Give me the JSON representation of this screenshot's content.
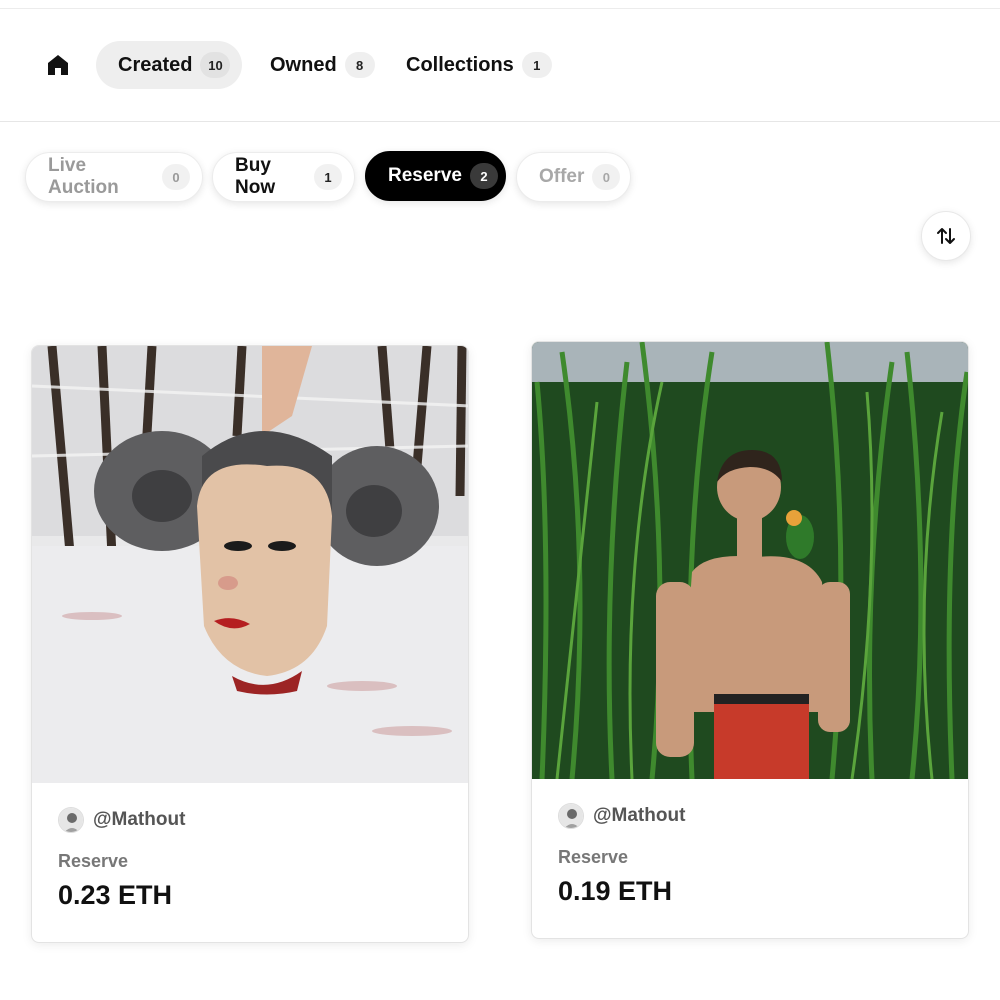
{
  "main_tabs": [
    {
      "label": "Created",
      "count": "10"
    },
    {
      "label": "Owned",
      "count": "8"
    },
    {
      "label": "Collections",
      "count": "1"
    }
  ],
  "filters": [
    {
      "label": "Live Auction",
      "count": "0"
    },
    {
      "label": "Buy Now",
      "count": "1"
    },
    {
      "label": "Reserve",
      "count": "2"
    },
    {
      "label": "Offer",
      "count": "0"
    }
  ],
  "active_tab": "Created",
  "active_filter": "Reserve",
  "cards": [
    {
      "creator": "@Mathout",
      "price_label": "Reserve",
      "price": "0.23 ETH",
      "artwork": "ram-horned-head-in-snow-artwork"
    },
    {
      "creator": "@Mathout",
      "price_label": "Reserve",
      "price": "0.19 ETH",
      "artwork": "man-in-tall-grass-with-parrot-artwork"
    }
  ],
  "icons": {
    "home": "home-icon",
    "sort": "sort-arrows-icon"
  },
  "colors": {
    "active_pill": "#000000",
    "muted_text": "#9a9a9a"
  }
}
